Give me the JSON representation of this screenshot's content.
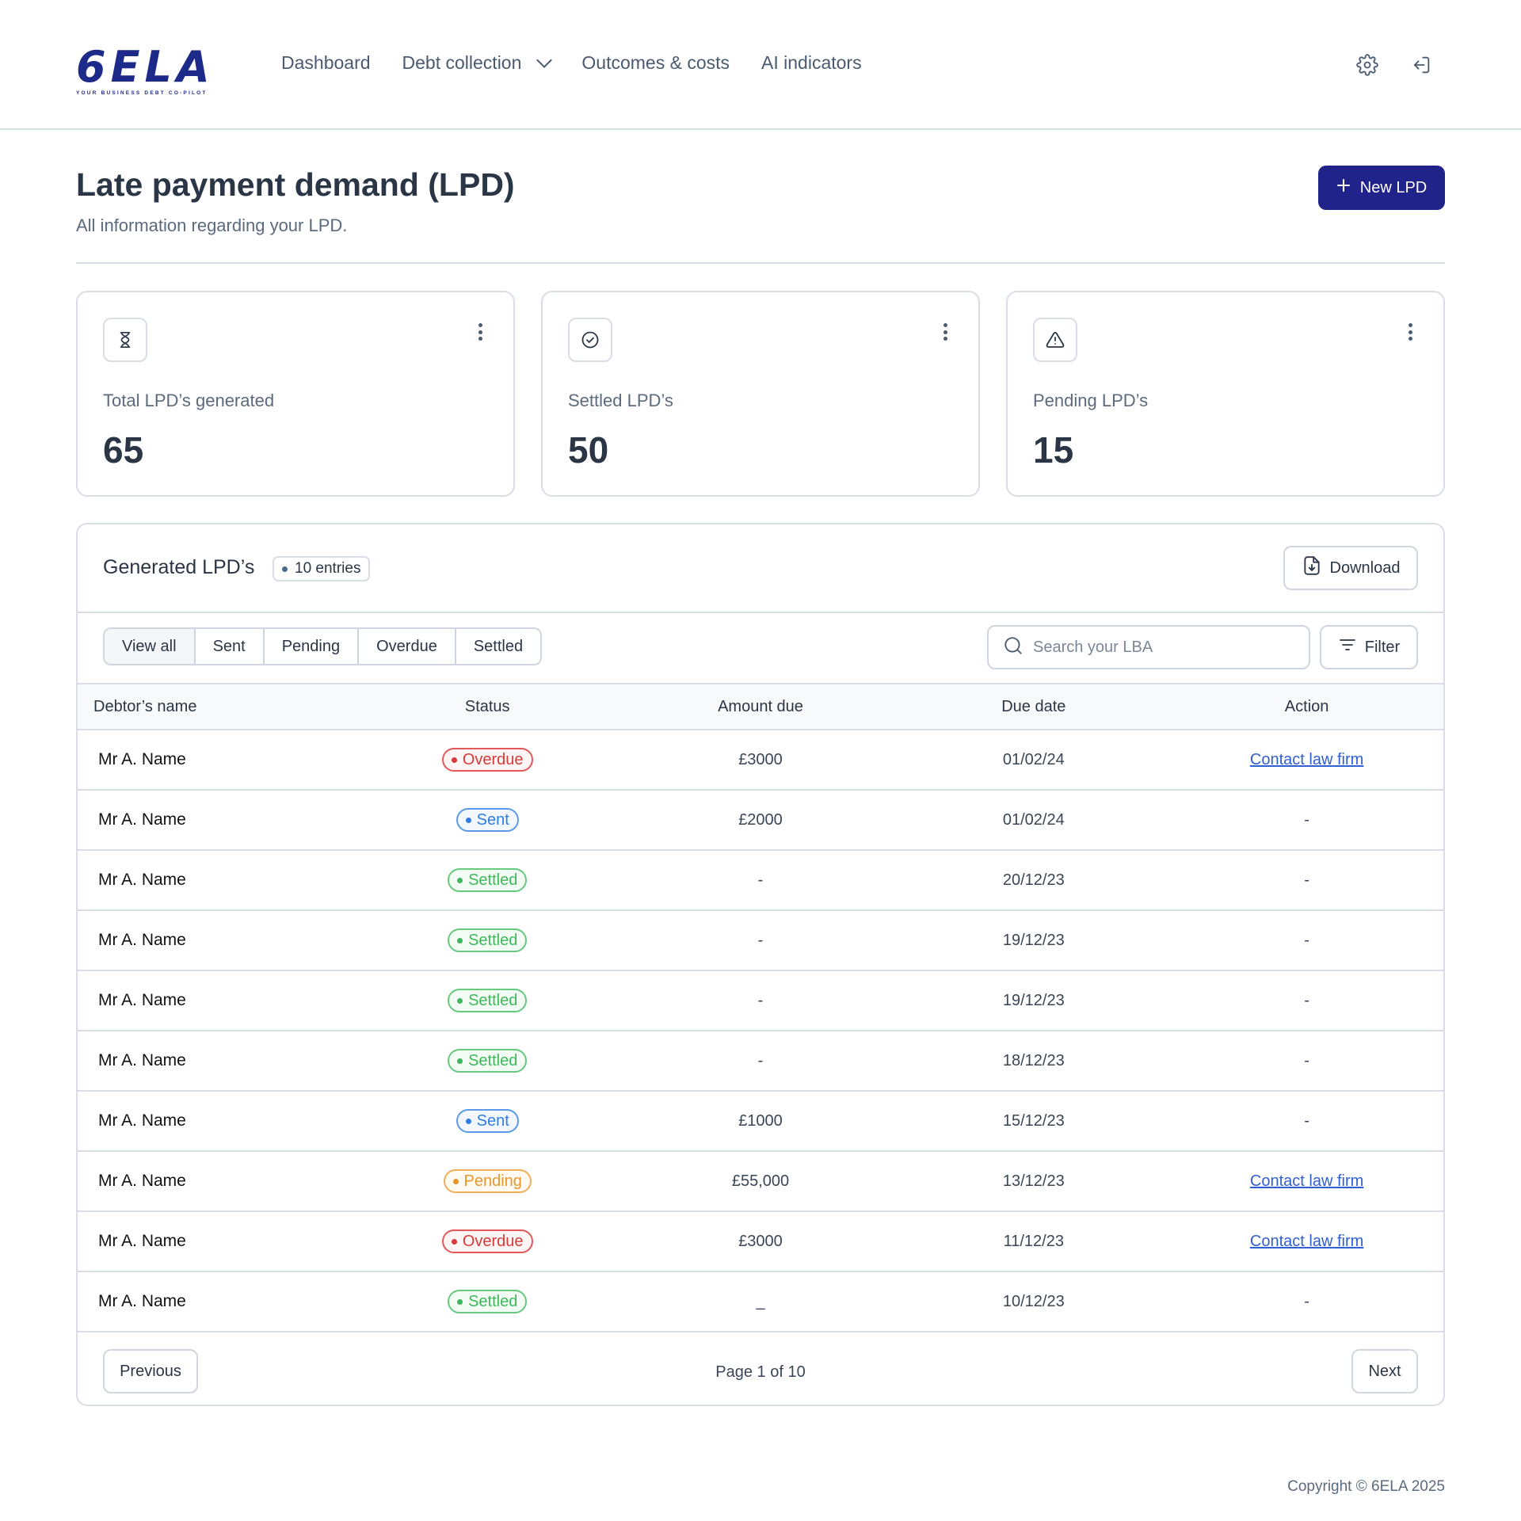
{
  "brand": {
    "logo_text": "6ELA",
    "tagline": "YOUR BUSINESS DEBT CO-PILOT",
    "color": "#1e2a8a"
  },
  "nav": {
    "items": [
      {
        "label": "Dashboard"
      },
      {
        "label": "Debt collection",
        "has_dropdown": true
      },
      {
        "label": "Outcomes & costs"
      },
      {
        "label": "AI indicators"
      }
    ],
    "icons": [
      "gear-icon",
      "logout-icon"
    ]
  },
  "page": {
    "title": "Late payment demand (LPD)",
    "subtitle": "All information regarding your LPD.",
    "new_button": "New LPD",
    "accent": "#1f238a"
  },
  "stats": [
    {
      "icon": "hourglass-icon",
      "label": "Total LPD’s generated",
      "value": "65"
    },
    {
      "icon": "check-circle-icon",
      "label": "Settled LPD’s",
      "value": "50"
    },
    {
      "icon": "warning-icon",
      "label": "Pending LPD’s",
      "value": "15"
    }
  ],
  "table_panel": {
    "title": "Generated LPD’s",
    "entries_badge": "10 entries",
    "download_label": "Download",
    "tabs": [
      "View all",
      "Sent",
      "Pending",
      "Overdue",
      "Settled"
    ],
    "active_tab": "View all",
    "search_placeholder": "Search your LBA",
    "filter_label": "Filter",
    "columns": [
      "Debtor’s name",
      "Status",
      "Amount due",
      "Due date",
      "Action"
    ],
    "rows": [
      {
        "name": "Mr A. Name",
        "status": "Overdue",
        "amount": "£3000",
        "date": "01/02/24",
        "action": "Contact law firm"
      },
      {
        "name": "Mr A. Name",
        "status": "Sent",
        "amount": "£2000",
        "date": "01/02/24",
        "action": "-"
      },
      {
        "name": "Mr A. Name",
        "status": "Settled",
        "amount": "-",
        "date": "20/12/23",
        "action": "-"
      },
      {
        "name": "Mr A. Name",
        "status": "Settled",
        "amount": "-",
        "date": "19/12/23",
        "action": "-"
      },
      {
        "name": "Mr A. Name",
        "status": "Settled",
        "amount": "-",
        "date": "19/12/23",
        "action": "-"
      },
      {
        "name": "Mr A. Name",
        "status": "Settled",
        "amount": "-",
        "date": "18/12/23",
        "action": "-"
      },
      {
        "name": "Mr A. Name",
        "status": "Sent",
        "amount": "£1000",
        "date": "15/12/23",
        "action": "-"
      },
      {
        "name": "Mr A. Name",
        "status": "Pending",
        "amount": "£55,000",
        "date": "13/12/23",
        "action": "Contact law firm"
      },
      {
        "name": "Mr A. Name",
        "status": "Overdue",
        "amount": "£3000",
        "date": "11/12/23",
        "action": "Contact law firm"
      },
      {
        "name": "Mr A. Name",
        "status": "Settled",
        "amount": "_",
        "date": "10/12/23",
        "action": "-"
      }
    ],
    "status_colors": {
      "Overdue": {
        "text": "#d63a3a",
        "border": "#e35858",
        "bg": "#fff5f5"
      },
      "Sent": {
        "text": "#2f7de1",
        "border": "#5a9ae8",
        "bg": "#f3f8ff"
      },
      "Settled": {
        "text": "#3db95a",
        "border": "#66c97e",
        "bg": "#f3fbf5"
      },
      "Pending": {
        "text": "#e6962a",
        "border": "#f0ae57",
        "bg": "#fffaf2"
      }
    },
    "pagination": {
      "previous": "Previous",
      "next": "Next",
      "page_text": "Page 1 of 10"
    }
  },
  "footer": {
    "copyright": "Copyright © 6ELA 2025"
  }
}
